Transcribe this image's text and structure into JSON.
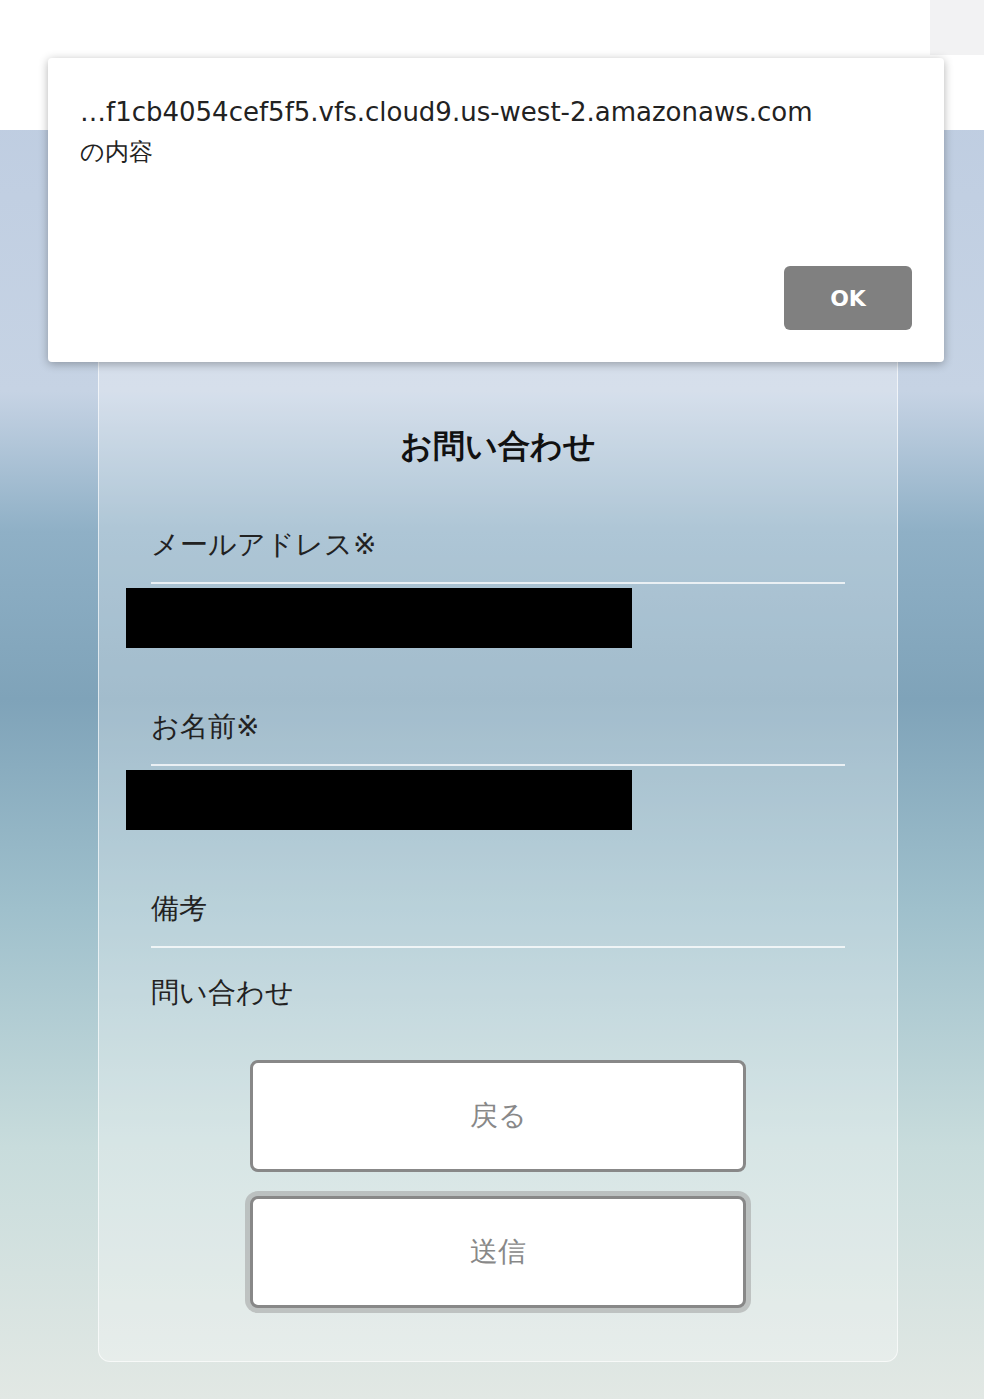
{
  "dialog": {
    "origin": "…f1cb4054cef5f5.vfs.cloud9.us-west-2.amazonaws.com",
    "suffix": "の内容",
    "buttons": [
      "OK"
    ]
  },
  "form": {
    "title": "お問い合わせ",
    "fields": [
      {
        "label": "メールアドレス※",
        "kind": "redacted"
      },
      {
        "label": "お名前※",
        "kind": "redacted"
      },
      {
        "label": "備考",
        "kind": "text",
        "value": "問い合わせ"
      }
    ],
    "buttons": [
      {
        "label": "戻る",
        "focused": false
      },
      {
        "label": "送信",
        "focused": true
      }
    ]
  }
}
